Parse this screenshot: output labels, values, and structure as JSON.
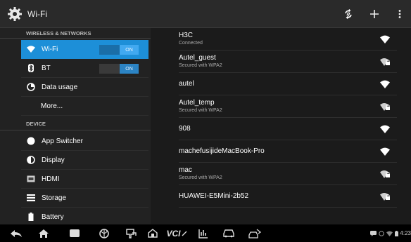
{
  "app": {
    "title": "Wi-Fi",
    "icon": "gear-icon"
  },
  "actionbar": {
    "sync_icon": "sync-icon",
    "add_icon": "plus-icon",
    "more_icon": "overflow-icon"
  },
  "sidebar": {
    "wireless_header": "WIRELESS & NETWORKS",
    "device_header": "DEVICE",
    "items": [
      {
        "label": "Wi-Fi",
        "icon": "wifi-icon",
        "toggle": "ON",
        "selected": true
      },
      {
        "label": "BT",
        "icon": "bluetooth-icon",
        "toggle": "ON"
      },
      {
        "label": "Data usage",
        "icon": "data-usage-icon"
      },
      {
        "label": "More..."
      },
      {
        "label": "App Switcher",
        "icon": "app-switcher-icon"
      },
      {
        "label": "Display",
        "icon": "display-icon"
      },
      {
        "label": "HDMI",
        "icon": "hdmi-icon"
      },
      {
        "label": "Storage",
        "icon": "storage-icon"
      },
      {
        "label": "Battery",
        "icon": "battery-icon"
      }
    ]
  },
  "networks": [
    {
      "name": "H3C",
      "status": "Connected",
      "secured": false
    },
    {
      "name": "Autel_guest",
      "status": "Secured with WPA2",
      "secured": true
    },
    {
      "name": "autel",
      "status": "",
      "secured": false
    },
    {
      "name": "Autel_temp",
      "status": "Secured with WPA2",
      "secured": true
    },
    {
      "name": "908",
      "status": "",
      "secured": false
    },
    {
      "name": "machefusijideMacBook-Pro",
      "status": "",
      "secured": false
    },
    {
      "name": "mac",
      "status": "Secured with WPA2",
      "secured": true
    },
    {
      "name": "HUAWEI-E5Mini-2b52",
      "status": "",
      "secured": true
    }
  ],
  "navbar": {
    "vci_label": "VCI",
    "status_time": "4:23",
    "icons": [
      "back-icon",
      "home-icon",
      "recent-apps-icon",
      "browser-icon",
      "vehicle-connect-icon",
      "house-icon",
      "vci-icon",
      "data-logging-icon",
      "car-icon",
      "car-service-icon"
    ]
  },
  "colors": {
    "accent": "#1d8fd8",
    "background": "#161616",
    "toggle_on": "#2c84c4"
  }
}
